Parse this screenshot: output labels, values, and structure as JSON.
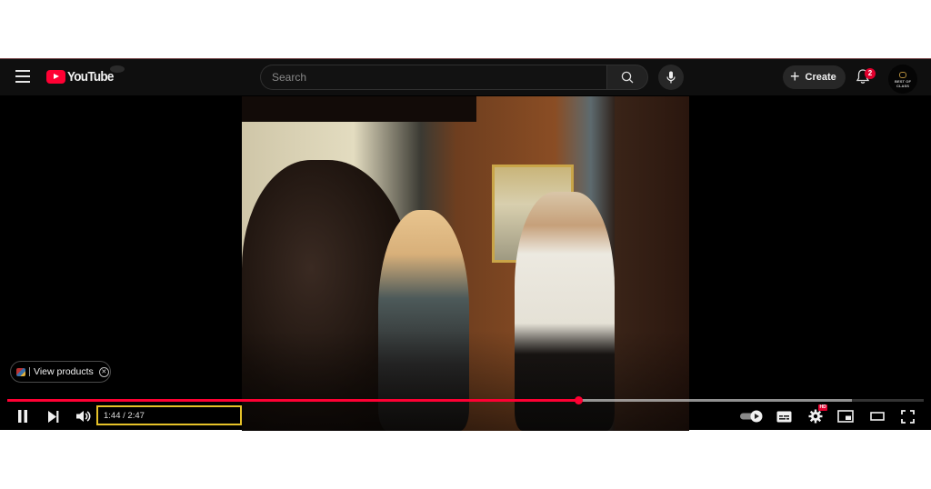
{
  "header": {
    "menu_icon": "hamburger-menu-icon",
    "logo_text": "YouTube",
    "search": {
      "placeholder": "Search",
      "value": ""
    },
    "search_icon": "search-icon",
    "mic_icon": "microphone-icon",
    "create_label": "Create",
    "notification_count": "2",
    "avatar_text": "BEST OF CLASS"
  },
  "player": {
    "overlay_chip": {
      "label": "View products",
      "close_icon": "close-circle-icon"
    },
    "progress": {
      "played_fraction": 0.624,
      "buffered_fraction": 0.922
    },
    "time": {
      "current": "1:44",
      "duration": "2:47",
      "display": "1:44 / 2:47"
    },
    "controls": {
      "left": [
        "pause",
        "next",
        "volume"
      ],
      "right": [
        "autoplay-toggle",
        "subtitles",
        "settings",
        "miniplayer",
        "theater-mode",
        "fullscreen"
      ]
    },
    "settings_badge": "HD"
  },
  "colors": {
    "accent": "#ff0033",
    "header_bg": "#0f0f0f",
    "highlight": "#e6c229"
  }
}
